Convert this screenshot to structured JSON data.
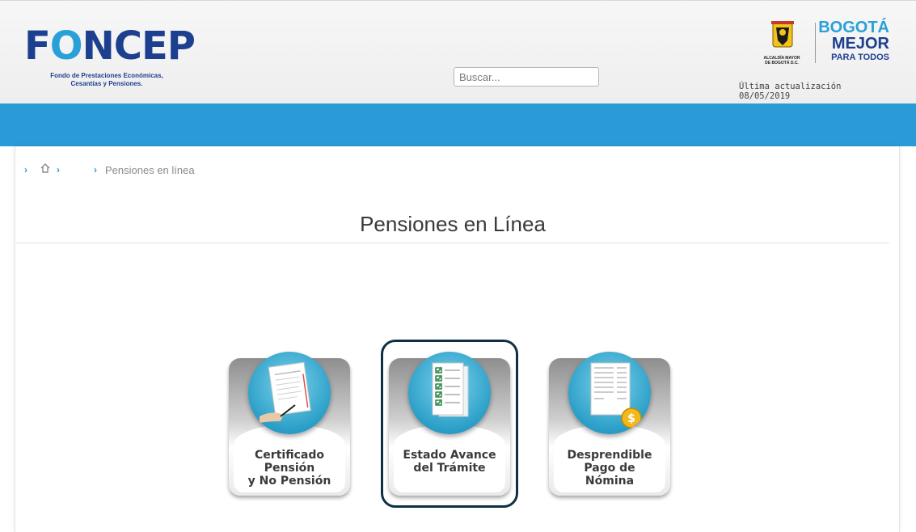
{
  "header": {
    "logo": {
      "text_pre": "F",
      "text_o": "O",
      "text_post": "NCEP",
      "subtitle_line1": "Fondo de Prestaciones Económicas,",
      "subtitle_line2": "Cesantías y Pensiones."
    },
    "search": {
      "placeholder": "Buscar..."
    },
    "alcaldia": {
      "caption_line1": "ALCALDÍA MAYOR",
      "caption_line2": "DE BOGOTÁ D.C."
    },
    "bogota": {
      "line1": "BOGOTÁ",
      "line2": "MEJOR",
      "line3": "PARA TODOS"
    },
    "last_update": "Última actualización 08/05/2019"
  },
  "breadcrumb": {
    "current": "Pensiones en línea"
  },
  "page": {
    "title": "Pensiones en Línea"
  },
  "cards": [
    {
      "label": "Certificado\nPensión\ny No Pensión",
      "icon": "certificate-document-icon"
    },
    {
      "label": "Estado Avance\ndel Trámite",
      "icon": "checklist-icon",
      "selected": true
    },
    {
      "label": "Desprendible\nPago de\nNómina",
      "icon": "payslip-icon"
    }
  ],
  "colors": {
    "brand_blue": "#2a9bd6",
    "logo_navy": "#1d3f8f",
    "selection_border": "#0f2f44"
  }
}
